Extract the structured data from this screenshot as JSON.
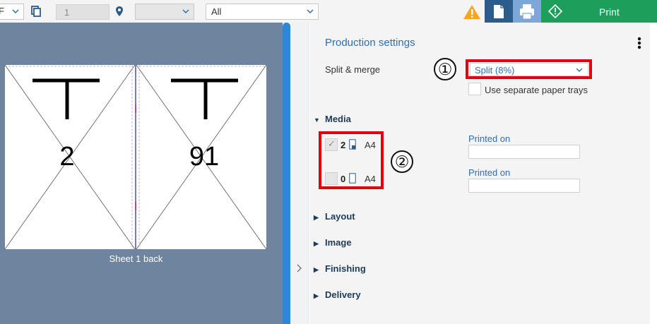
{
  "toolbar": {
    "left_select_value": "F",
    "sheet_number": "1",
    "location_select_value": "",
    "filter_select_value": "All",
    "print_label": "Print"
  },
  "preview": {
    "pages": [
      {
        "number": "2"
      },
      {
        "number": "91"
      }
    ],
    "sheet_caption": "Sheet 1 back"
  },
  "panel": {
    "title": "Production settings",
    "split_merge_label": "Split & merge",
    "split_merge_value": "Split (8%)",
    "separate_trays_label": "Use separate paper trays",
    "separate_trays_checked": false,
    "callouts": [
      "①",
      "②"
    ],
    "sections": {
      "media": "Media",
      "layout": "Layout",
      "image": "Image",
      "finishing": "Finishing",
      "delivery": "Delivery"
    },
    "media_rows": [
      {
        "checked": true,
        "count": "2",
        "size": "A4",
        "printed_on_label": "Printed on",
        "printed_on_value": ""
      },
      {
        "checked": false,
        "count": "0",
        "size": "A4",
        "printed_on_label": "Printed on",
        "printed_on_value": ""
      }
    ]
  },
  "colors": {
    "accent_blue": "#2c6fb0",
    "print_green": "#1d9e5b",
    "callout_red": "#e1000f",
    "warning": "#f5a623"
  }
}
